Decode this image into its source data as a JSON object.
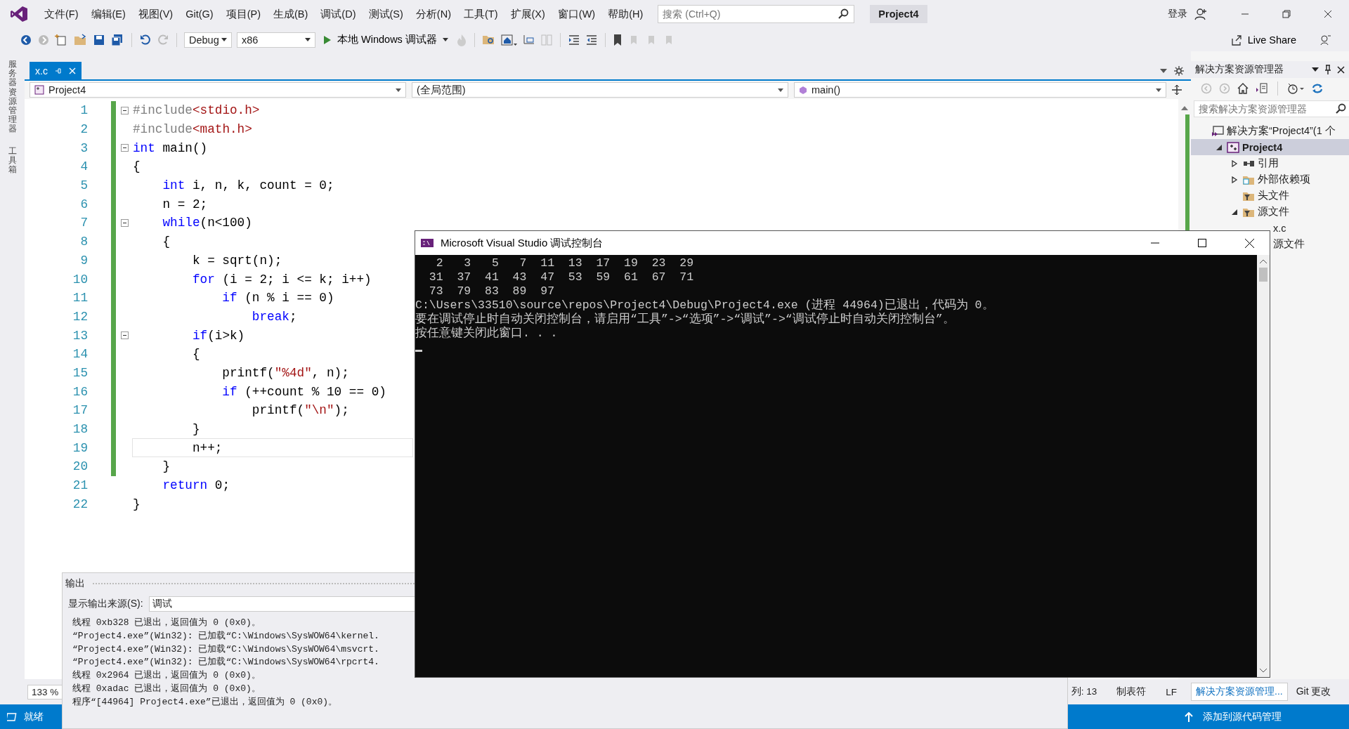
{
  "title_bar": {
    "menus": [
      "文件(F)",
      "编辑(E)",
      "视图(V)",
      "Git(G)",
      "项目(P)",
      "生成(B)",
      "调试(D)",
      "测试(S)",
      "分析(N)",
      "工具(T)",
      "扩展(X)",
      "窗口(W)",
      "帮助(H)"
    ],
    "search": {
      "placeholder": "搜索 (Ctrl+Q)"
    },
    "solution_name": "Project4",
    "sign_in": "登录"
  },
  "toolbar": {
    "configuration": "Debug",
    "platform": "x86",
    "run_button": "本地 Windows 调试器",
    "live_share": "Live Share"
  },
  "side_tabs": [
    "服务器资源管理器",
    "工具箱"
  ],
  "document_tabs": [
    {
      "label": "x.c",
      "selected": true
    }
  ],
  "navigation": {
    "project": "Project4",
    "scope": "(全局范围)",
    "member": "main()"
  },
  "editor": {
    "lines": [
      {
        "number": "1",
        "fold": true,
        "changed": true,
        "current": false,
        "tokens": [
          {
            "kind": "pp",
            "text": "#include"
          },
          {
            "kind": "str",
            "text": "<stdio.h>"
          }
        ]
      },
      {
        "number": "2",
        "fold": false,
        "changed": true,
        "current": false,
        "tokens": [
          {
            "kind": "pp",
            "text": "#include"
          },
          {
            "kind": "str",
            "text": "<math.h>"
          }
        ]
      },
      {
        "number": "3",
        "fold": true,
        "changed": true,
        "current": false,
        "tokens": [
          {
            "kind": "kw",
            "text": "int"
          },
          {
            "kind": "plain",
            "text": " main()"
          }
        ]
      },
      {
        "number": "4",
        "fold": false,
        "changed": true,
        "current": false,
        "tokens": [
          {
            "kind": "plain",
            "text": "{"
          }
        ]
      },
      {
        "number": "5",
        "fold": false,
        "changed": true,
        "current": false,
        "tokens": [
          {
            "kind": "kw",
            "text": "    int"
          },
          {
            "kind": "plain",
            "text": " i, n, k, count = 0;"
          }
        ]
      },
      {
        "number": "6",
        "fold": false,
        "changed": true,
        "current": false,
        "tokens": [
          {
            "kind": "plain",
            "text": "    n = 2;"
          }
        ]
      },
      {
        "number": "7",
        "fold": true,
        "changed": true,
        "current": false,
        "tokens": [
          {
            "kind": "kw",
            "text": "    while"
          },
          {
            "kind": "plain",
            "text": "(n<100)"
          }
        ]
      },
      {
        "number": "8",
        "fold": false,
        "changed": true,
        "current": false,
        "tokens": [
          {
            "kind": "plain",
            "text": "    {"
          }
        ]
      },
      {
        "number": "9",
        "fold": false,
        "changed": true,
        "current": false,
        "tokens": [
          {
            "kind": "plain",
            "text": "        k = sqrt(n);"
          }
        ]
      },
      {
        "number": "10",
        "fold": false,
        "changed": true,
        "current": false,
        "tokens": [
          {
            "kind": "kw",
            "text": "        for"
          },
          {
            "kind": "plain",
            "text": " (i = 2; i <= k; i++)"
          }
        ]
      },
      {
        "number": "11",
        "fold": false,
        "changed": true,
        "current": false,
        "tokens": [
          {
            "kind": "kw",
            "text": "            if"
          },
          {
            "kind": "plain",
            "text": " (n % i == 0)"
          }
        ]
      },
      {
        "number": "12",
        "fold": false,
        "changed": true,
        "current": false,
        "tokens": [
          {
            "kind": "kw",
            "text": "                break"
          },
          {
            "kind": "plain",
            "text": ";"
          }
        ]
      },
      {
        "number": "13",
        "fold": true,
        "changed": true,
        "current": false,
        "tokens": [
          {
            "kind": "kw",
            "text": "        if"
          },
          {
            "kind": "plain",
            "text": "(i>k)"
          }
        ]
      },
      {
        "number": "14",
        "fold": false,
        "changed": true,
        "current": false,
        "tokens": [
          {
            "kind": "plain",
            "text": "        {"
          }
        ]
      },
      {
        "number": "15",
        "fold": false,
        "changed": true,
        "current": false,
        "tokens": [
          {
            "kind": "plain",
            "text": "            printf("
          },
          {
            "kind": "str",
            "text": "\"%4d\""
          },
          {
            "kind": "plain",
            "text": ", n);"
          }
        ]
      },
      {
        "number": "16",
        "fold": false,
        "changed": true,
        "current": false,
        "tokens": [
          {
            "kind": "kw",
            "text": "            if"
          },
          {
            "kind": "plain",
            "text": " (++count % 10 == 0)"
          }
        ]
      },
      {
        "number": "17",
        "fold": false,
        "changed": true,
        "current": false,
        "tokens": [
          {
            "kind": "plain",
            "text": "                printf("
          },
          {
            "kind": "str",
            "text": "\"\\n\""
          },
          {
            "kind": "plain",
            "text": ");"
          }
        ]
      },
      {
        "number": "18",
        "fold": false,
        "changed": true,
        "current": false,
        "tokens": [
          {
            "kind": "plain",
            "text": "        }"
          }
        ]
      },
      {
        "number": "19",
        "fold": false,
        "changed": true,
        "current": true,
        "tokens": [
          {
            "kind": "plain",
            "text": "        n++;"
          }
        ]
      },
      {
        "number": "20",
        "fold": false,
        "changed": true,
        "current": false,
        "tokens": [
          {
            "kind": "plain",
            "text": "    }"
          }
        ]
      },
      {
        "number": "21",
        "fold": false,
        "changed": false,
        "current": false,
        "tokens": [
          {
            "kind": "kw",
            "text": "    return"
          },
          {
            "kind": "plain",
            "text": " 0;"
          }
        ]
      },
      {
        "number": "22",
        "fold": false,
        "changed": false,
        "current": false,
        "tokens": [
          {
            "kind": "plain",
            "text": "}"
          }
        ]
      }
    ],
    "zoom": "133 %",
    "column": "列: 13",
    "indent": "制表符",
    "line_ending": "LF"
  },
  "solution_explorer": {
    "title": "解决方案资源管理器",
    "search": {
      "placeholder": "搜索解决方案资源管理器"
    },
    "tree": [
      {
        "label": "解决方案“Project4”(1 个",
        "kind": "solution",
        "expandable": false,
        "selected": false,
        "children": [
          {
            "label": "Project4",
            "kind": "project",
            "expandable": true,
            "expanded": true,
            "selected": true,
            "children": [
              {
                "label": "引用",
                "kind": "references",
                "expandable": true,
                "expanded": false,
                "selected": false
              },
              {
                "label": "外部依赖项",
                "kind": "dependencies",
                "expandable": true,
                "expanded": false,
                "selected": false
              },
              {
                "label": "头文件",
                "kind": "filter",
                "expandable": false,
                "selected": false
              },
              {
                "label": "源文件",
                "kind": "filter",
                "expandable": true,
                "expanded": true,
                "selected": false,
                "children": [
                  {
                    "label": "x.c",
                    "expandable": false,
                    "selected": false
                  },
                  {
                    "label": "源文件",
                    "expandable": false,
                    "selected": false
                  }
                ]
              }
            ]
          }
        ]
      }
    ],
    "tabs": [
      {
        "label": "解决方案资源管理...",
        "selected": true
      },
      {
        "label": "Git 更改",
        "selected": false
      }
    ]
  },
  "output": {
    "title": "输出",
    "source_label": "显示输出来源(S):",
    "source": "调试",
    "lines": [
      "线程 0xb328 已退出，返回值为 0 (0x0)。",
      "“Project4.exe”(Win32): 已加载“C:\\Windows\\SysWOW64\\kernel.",
      "“Project4.exe”(Win32): 已加载“C:\\Windows\\SysWOW64\\msvcrt.",
      "“Project4.exe”(Win32): 已加载“C:\\Windows\\SysWOW64\\rpcrt4.",
      "线程 0x2964 已退出，返回值为 0 (0x0)。",
      "线程 0xadac 已退出，返回值为 0 (0x0)。",
      "程序“[44964] Project4.exe”已退出，返回值为 0 (0x0)。"
    ]
  },
  "console": {
    "title": "Microsoft Visual Studio 调试控制台",
    "lines": [
      "   2   3   5   7  11  13  17  19  23  29",
      "  31  37  41  43  47  53  59  61  67  71",
      "  73  79  83  89  97",
      "C:\\Users\\33510\\source\\repos\\Project4\\Debug\\Project4.exe (进程 44964)已退出，代码为 0。",
      "要在调试停止时自动关闭控制台，请启用“工具”->“选项”->“调试”->“调试停止时自动关闭控制台”。",
      "按任意键关闭此窗口. . ."
    ]
  },
  "status_bar": {
    "state": "就绪",
    "source_control": "添加到源代码管理"
  }
}
